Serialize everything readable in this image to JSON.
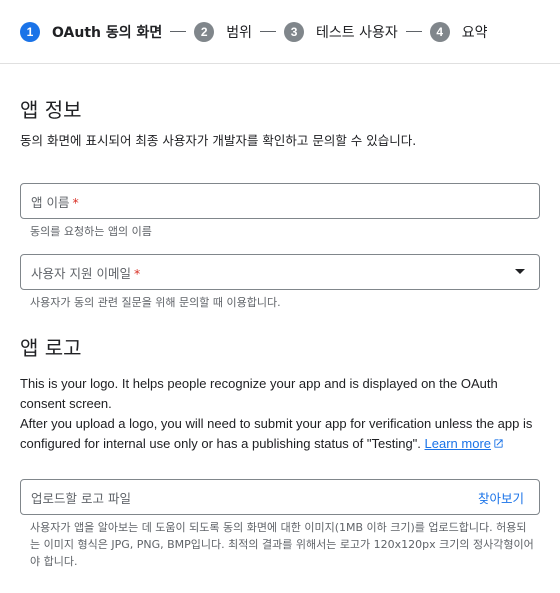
{
  "stepper": {
    "steps": [
      {
        "num": "1",
        "label": "OAuth 동의 화면"
      },
      {
        "num": "2",
        "label": "범위"
      },
      {
        "num": "3",
        "label": "테스트 사용자"
      },
      {
        "num": "4",
        "label": "요약"
      }
    ]
  },
  "app_info": {
    "title": "앱 정보",
    "description": "동의 화면에 표시되어 최종 사용자가 개발자를 확인하고 문의할 수 있습니다.",
    "app_name": {
      "label": "앱 이름",
      "required": "*",
      "hint": "동의를 요청하는 앱의 이름"
    },
    "support_email": {
      "label": "사용자 지원 이메일",
      "required": "*",
      "hint": "사용자가 동의 관련 질문을 위해 문의할 때 이용합니다."
    }
  },
  "app_logo": {
    "title": "앱 로고",
    "desc_line1": "This is your logo. It helps people recognize your app and is displayed on the OAuth consent screen.",
    "desc_line2": "After you upload a logo, you will need to submit your app for verification unless the app is configured for internal use only or has a publishing status of \"Testing\".",
    "learn_more": "Learn more",
    "upload_field": {
      "label": "업로드할 로고 파일",
      "browse": "찾아보기"
    },
    "upload_hint": "사용자가 앱을 알아보는 데 도움이 되도록 동의 화면에 대한 이미지(1MB 이하 크기)를 업로드합니다. 허용되는 이미지 형식은 JPG, PNG, BMP입니다. 최적의 결과를 위해서는 로고가 120x120px 크기의 정사각형이어야 합니다."
  },
  "colors": {
    "accent": "#1a73e8",
    "required": "#d93025",
    "step_inactive": "#80868b"
  }
}
